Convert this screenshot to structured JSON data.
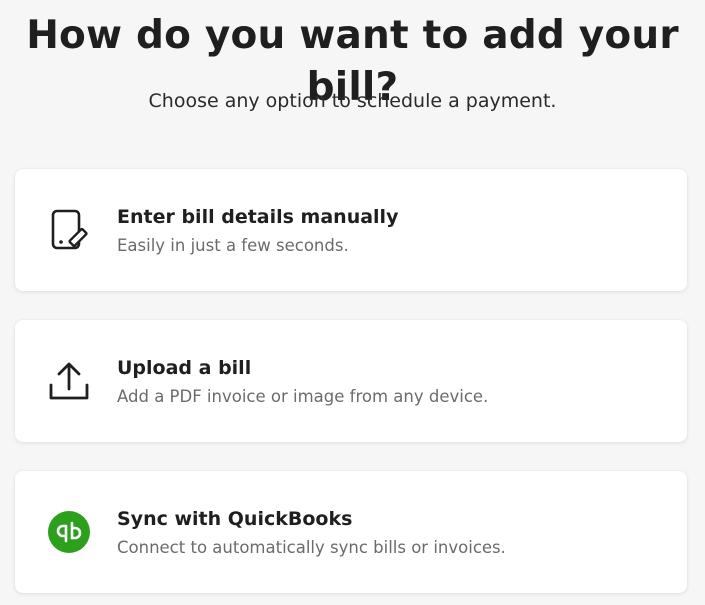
{
  "header": {
    "title": "How do you want to add your bill?",
    "subtitle": "Choose any option to schedule a payment."
  },
  "options": [
    {
      "title": "Enter bill details manually",
      "description": "Easily in just a few seconds.",
      "icon": "document-edit-icon"
    },
    {
      "title": "Upload a bill",
      "description": "Add a PDF invoice or image from any device.",
      "icon": "upload-icon"
    },
    {
      "title": "Sync with QuickBooks",
      "description": "Connect to automatically sync bills or invoices.",
      "icon": "quickbooks-icon"
    }
  ],
  "colors": {
    "background": "#f6f6f6",
    "card": "#ffffff",
    "title_text": "#1f1f1f",
    "description_text": "#6b6b6b",
    "quickbooks_green": "#2ca01c"
  }
}
